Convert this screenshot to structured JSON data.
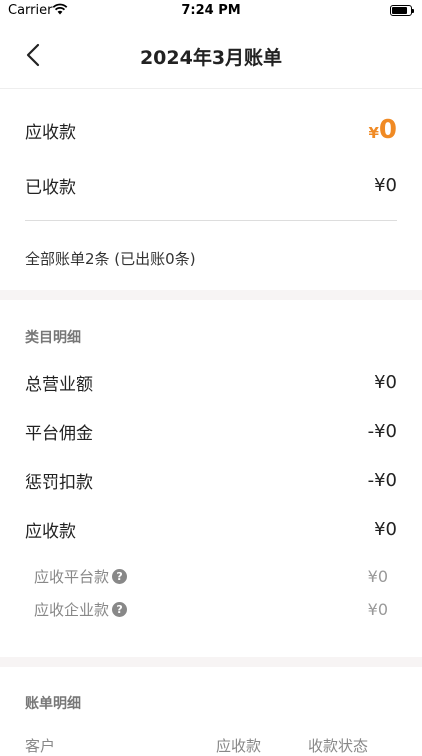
{
  "status_bar": {
    "carrier": "Carrier",
    "time": "7:24 PM"
  },
  "navbar": {
    "title": "2024年3月账单",
    "back_icon": "chevron-left-icon"
  },
  "summary": {
    "receivable_label": "应收款",
    "receivable_currency": "¥",
    "receivable_amount": "0",
    "received_label": "已收款",
    "received_value": "¥0",
    "bill_count_text": "全部账单2条 (已出账0条)"
  },
  "category": {
    "title": "类目明细",
    "rows": [
      {
        "label": "总营业额",
        "value": "¥0"
      },
      {
        "label": "平台佣金",
        "value": "-¥0"
      },
      {
        "label": "惩罚扣款",
        "value": "-¥0"
      },
      {
        "label": "应收款",
        "value": "¥0"
      }
    ],
    "subrows": [
      {
        "label": "应收平台款",
        "value": "¥0",
        "help_icon": "question-icon"
      },
      {
        "label": "应收企业款",
        "value": "¥0",
        "help_icon": "question-icon"
      }
    ]
  },
  "bill_detail": {
    "title": "账单明细",
    "columns": [
      "客户",
      "应收款",
      "收款状态"
    ]
  },
  "colors": {
    "accent": "#f08a24",
    "section_band": "#f7f4f4"
  }
}
